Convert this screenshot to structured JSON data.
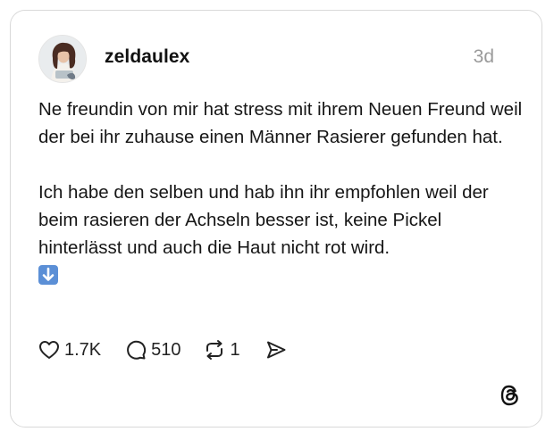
{
  "post": {
    "username": "zeldaulex",
    "timestamp": "3d",
    "paragraph1": "Ne freundin von mir hat stress mit ihrem Neuen Freund weil der bei ihr zuhause einen Männer Rasierer gefunden hat.",
    "paragraph2": "Ich habe den selben und hab ihn ihr empfohlen weil der beim rasieren der Achseln besser ist, keine Pickel hinterlässt und auch die Haut nicht rot wird.",
    "emoji": "down-arrow-emoji"
  },
  "actions": {
    "likes": "1.7K",
    "replies": "510",
    "reposts": "1"
  },
  "icons": {
    "like": "heart-icon",
    "reply": "comment-bubble-icon",
    "repost": "repost-icon",
    "share": "send-icon",
    "brand": "threads-logo-icon"
  },
  "colors": {
    "text": "#111111",
    "muted": "#9a9a9a",
    "border": "#d9d9d9",
    "emoji_blue": "#5b8fd6"
  }
}
